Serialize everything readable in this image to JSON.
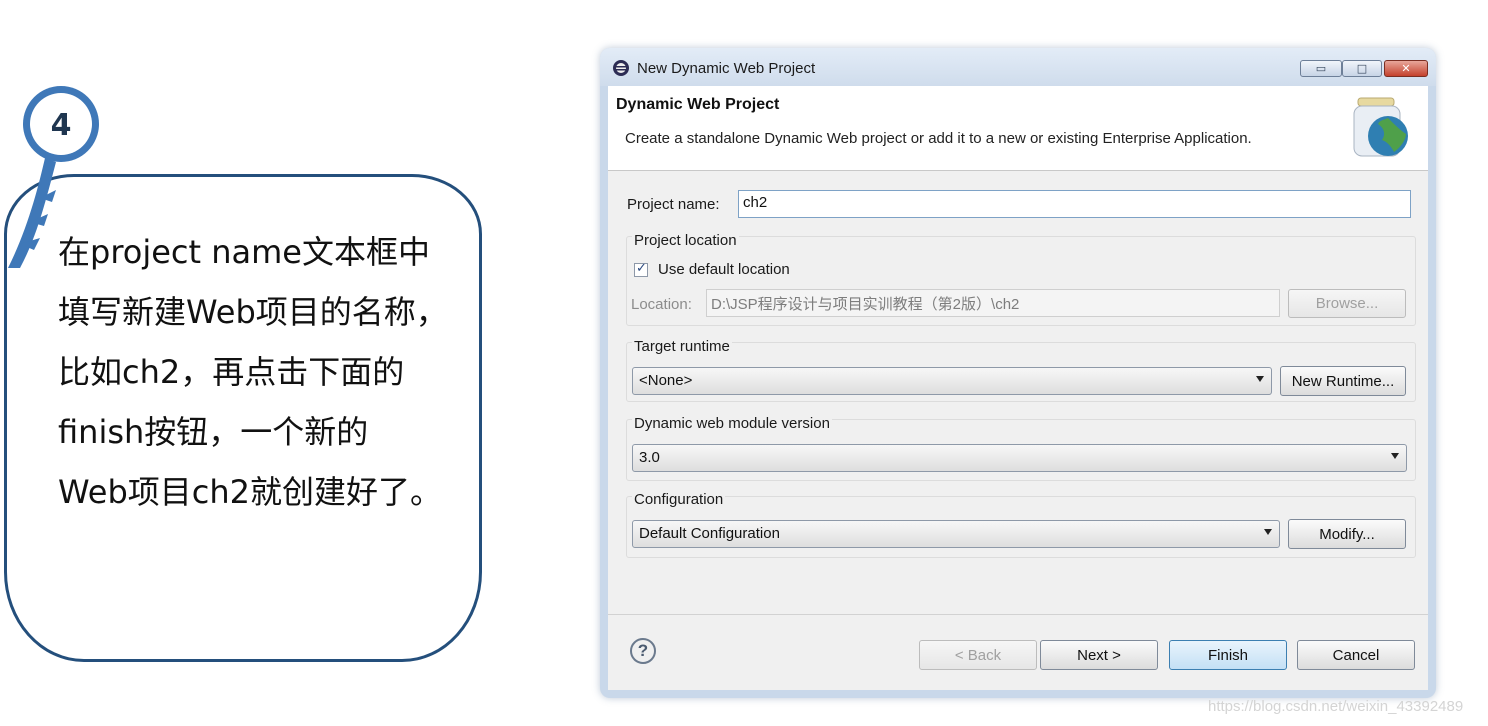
{
  "callout": {
    "step_number": "4",
    "lines": [
      "在project name文本框中",
      "填写新建Web项目的名称，",
      "比如ch2，再点击下面的",
      "finish按钮，一个新的",
      "Web项目ch2就创建好了。"
    ]
  },
  "window": {
    "title": "New Dynamic Web Project",
    "min_glyph": "▭",
    "max_glyph": "□",
    "close_glyph": "✕"
  },
  "banner": {
    "title": "Dynamic Web Project",
    "description": "Create a standalone Dynamic Web project or add it to a new or existing Enterprise Application."
  },
  "project_name": {
    "label": "Project name:",
    "value": "ch2"
  },
  "project_location": {
    "group_label": "Project location",
    "use_default_label": "Use default location",
    "use_default_checked": true,
    "check_glyph": "✓",
    "location_label": "Location:",
    "location_value": "D:\\JSP程序设计与项目实训教程（第2版）\\ch2",
    "browse_label": "Browse..."
  },
  "target_runtime": {
    "group_label": "Target runtime",
    "selected": "<None>",
    "new_runtime_label": "New Runtime..."
  },
  "module_version": {
    "group_label": "Dynamic web module version",
    "selected": "3.0"
  },
  "configuration": {
    "group_label": "Configuration",
    "selected": "Default Configuration",
    "modify_label": "Modify..."
  },
  "footer": {
    "help_glyph": "?",
    "back_label": "< Back",
    "next_label": "Next >",
    "finish_label": "Finish",
    "cancel_label": "Cancel"
  },
  "watermark": "https://blog.csdn.net/weixin_43392489",
  "colors": {
    "callout_border": "#244f7c",
    "pin_blue": "#3f78b8",
    "title_gradient_top": "#e3ecf7"
  }
}
